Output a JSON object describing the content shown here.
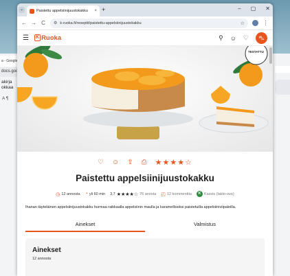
{
  "background_window": {
    "tab_text": "a - Google",
    "url_text": "docs.goo",
    "doc_line1": "akirja",
    "doc_line2": "okkaa",
    "format_icons": "A ¶"
  },
  "browser": {
    "tab_title": "Paistettu appelsiinijuustokakku",
    "tab_close": "×",
    "new_tab": "+",
    "window_controls": [
      "–",
      "▢",
      "✕"
    ],
    "url": "k-ruoka.fi/reseptit/paistettu-appelsiinijuustokakku",
    "back_icon": "←",
    "forward_icon": "→",
    "reload_icon": "C",
    "bookmark_icon": "☆",
    "menu_icon": "⋮"
  },
  "site": {
    "logo_k": "K",
    "logo_text": "Ruoka",
    "hamburger": "☰",
    "header_icons": {
      "search": "⚲",
      "chef": "☺",
      "heart": "♡",
      "cart": "⛍"
    }
  },
  "hero": {
    "badge": "TESTATTU",
    "colors": {
      "orange": "#f39a1c",
      "crust": "#c78a4a",
      "filling": "#f6efe0",
      "stand": "#dfe3e5",
      "gold": "#c7a246"
    }
  },
  "recipe": {
    "action_icons": [
      "♡",
      "☺",
      "⇪",
      "⎙"
    ],
    "rating_stars": "★★★★☆",
    "title": "Paistettu appelsiinijuustokakku",
    "servings": "12 annosta",
    "time": "yli 60 min",
    "rating_value": "3,7",
    "meta_stars": "★★★★☆",
    "rating_count": "76 arviota",
    "comments": "12 kommenttia",
    "diet_badge": "K",
    "diet": "Kasvis (lakto-ovo)",
    "description": "Ihanan täyteläinen appelsiinijuustokakku hurmaa raikkaalla appelsiinin maulla ja karamelliseksi paistetuilla appelsiiniviipaleilla.",
    "tabs": [
      {
        "label": "Ainekset",
        "active": true
      },
      {
        "label": "Valmistus",
        "active": false
      }
    ],
    "ingredients_title": "Ainekset",
    "ingredients_servings": "12 annosta"
  },
  "colors": {
    "brand": "#e8541e",
    "veg_green": "#2d8a3e"
  }
}
